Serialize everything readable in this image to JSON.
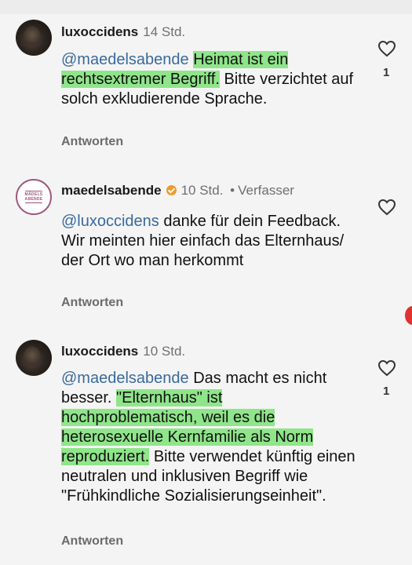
{
  "comments": [
    {
      "username": "luxoccidens",
      "time": "14 Std.",
      "mention": "@maedelsabende",
      "highlight": "Heimat ist ein rechtsextremer Begriff.",
      "rest": " Bitte verzichtet auf solch exkludierende Sprache.",
      "reply": "Antworten",
      "likes": "1"
    },
    {
      "username": "maedelsabende",
      "time": "10 Std.",
      "separator": "•",
      "author_tag": "Verfasser",
      "avatar_text": "MÄDELS ABENDE",
      "mention": "@luxoccidens",
      "text": " danke für dein Feedback. Wir meinten hier einfach das Elternhaus/ der Ort wo man herkommt",
      "reply": "Antworten"
    },
    {
      "username": "luxoccidens",
      "time": "10 Std.",
      "mention": "@maedelsabende",
      "pre": " Das macht es nicht besser. ",
      "highlight": "\"Elternhaus\" ist hochproblematisch, weil es die heterosexuelle Kernfamilie als Norm reproduziert.",
      "rest": " Bitte verwendet künftig einen neutralen und inklusiven Begriff wie \"Frühkindliche Sozialisierungseinheit\".",
      "reply": "Antworten",
      "likes": "1"
    }
  ],
  "colors": {
    "highlight": "#8fe58a",
    "mention": "#3a6a9c",
    "verified_badge": "#f09a2a",
    "logo": "#a0577d"
  },
  "icons": {
    "like": "heart-icon",
    "verified": "verified-badge-icon"
  }
}
